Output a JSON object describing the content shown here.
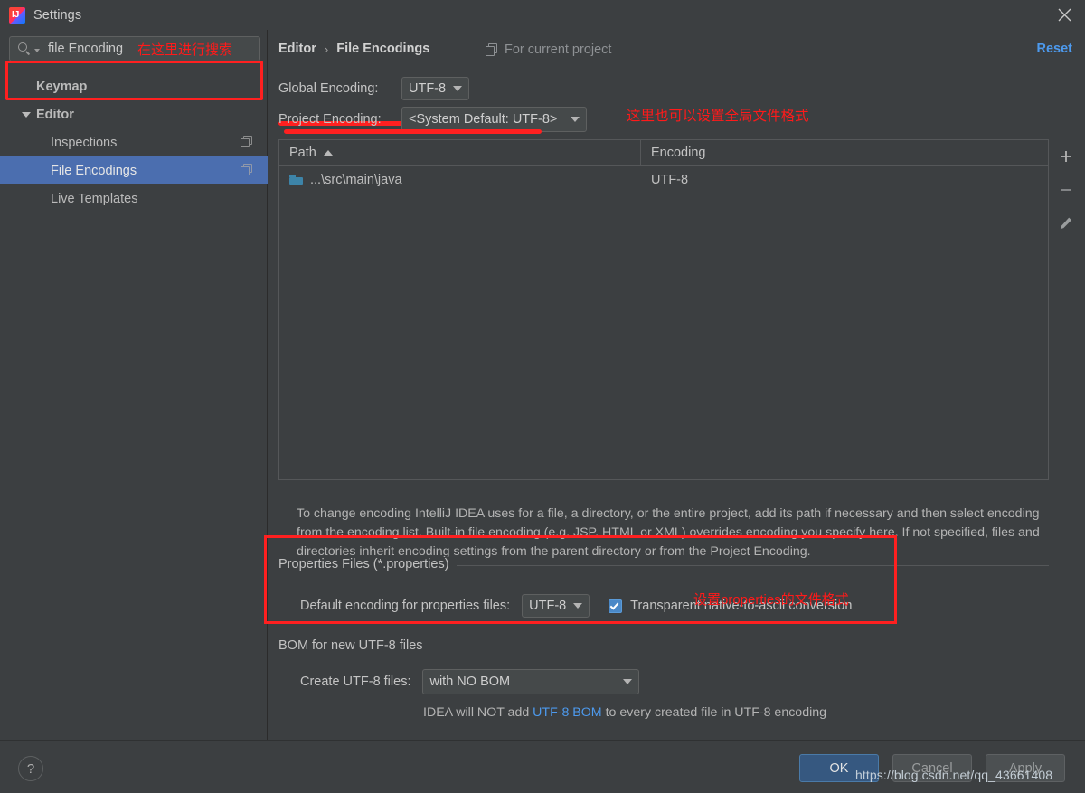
{
  "window": {
    "title": "Settings",
    "logo_icon": "intellij-idea-logo",
    "close_icon": "close-icon"
  },
  "sidebar": {
    "search": {
      "icon": "search-icon",
      "dropdown_icon": "chevron-down-icon",
      "value": "file Encoding",
      "annotation": "在这里进行搜索"
    },
    "items": [
      {
        "label": "Keymap",
        "level": 0,
        "selected": false,
        "expandable": false,
        "copy_icon": false
      },
      {
        "label": "Editor",
        "level": 0,
        "selected": false,
        "expandable": true,
        "expanded": true,
        "copy_icon": false
      },
      {
        "label": "Inspections",
        "level": 1,
        "selected": false,
        "expandable": false,
        "copy_icon": true
      },
      {
        "label": "File Encodings",
        "level": 1,
        "selected": true,
        "expandable": false,
        "copy_icon": true
      },
      {
        "label": "Live Templates",
        "level": 1,
        "selected": false,
        "expandable": false,
        "copy_icon": false
      }
    ]
  },
  "content": {
    "breadcrumb": {
      "parent": "Editor",
      "separator": "›",
      "current": "File Encodings"
    },
    "for_current_project": {
      "label": "For current project",
      "icon": "copy-icon"
    },
    "reset_label": "Reset",
    "global_encoding": {
      "label": "Global Encoding:",
      "value": "UTF-8"
    },
    "project_encoding": {
      "label": "Project Encoding:",
      "value": "<System Default: UTF-8>"
    },
    "annotation_encoding": "这里也可以设置全局文件格式",
    "table": {
      "columns": [
        "Path",
        "Encoding"
      ],
      "sort_column": "Path",
      "sort_direction": "asc",
      "rows": [
        {
          "path": "...\\src\\main\\java",
          "encoding": "UTF-8",
          "icon": "folder-icon"
        }
      ],
      "toolbar": [
        {
          "name": "add-button",
          "icon": "plus-icon"
        },
        {
          "name": "remove-button",
          "icon": "minus-icon"
        },
        {
          "name": "edit-button",
          "icon": "pencil-icon"
        }
      ]
    },
    "description": "To change encoding IntelliJ IDEA uses for a file, a directory, or the entire project, add its path if necessary and then select encoding from the encoding list. Built-in file encoding (e.g. JSP, HTML or XML) overrides encoding you specify here. If not specified, files and directories inherit encoding settings from the parent directory or from the Project Encoding.",
    "properties_group": {
      "title": "Properties Files (*.properties)",
      "default_encoding_label": "Default encoding for properties files:",
      "default_encoding_value": "UTF-8",
      "transparent_label": "Transparent native-to-ascii conversion",
      "transparent_checked": true,
      "annotation": "设置properties的文件格式"
    },
    "bom_group": {
      "title": "BOM for new UTF-8 files",
      "create_label": "Create UTF-8 files:",
      "create_value": "with NO BOM",
      "hint_prefix": "IDEA will NOT add ",
      "hint_link": "UTF-8 BOM",
      "hint_suffix": " to every created file in UTF-8 encoding"
    }
  },
  "footer": {
    "help_label": "?",
    "ok_label": "OK",
    "cancel_label": "Cancel",
    "apply_label": "Apply",
    "watermark": "https://blog.csdn.net/qq_43661408"
  },
  "colors": {
    "background": "#3c3f41",
    "selection_blue": "#4b6eaf",
    "accent_link": "#4d9aee",
    "annotation_red": "#ff2020",
    "primary_button": "#365880",
    "folder_blue": "#3d84a8"
  }
}
